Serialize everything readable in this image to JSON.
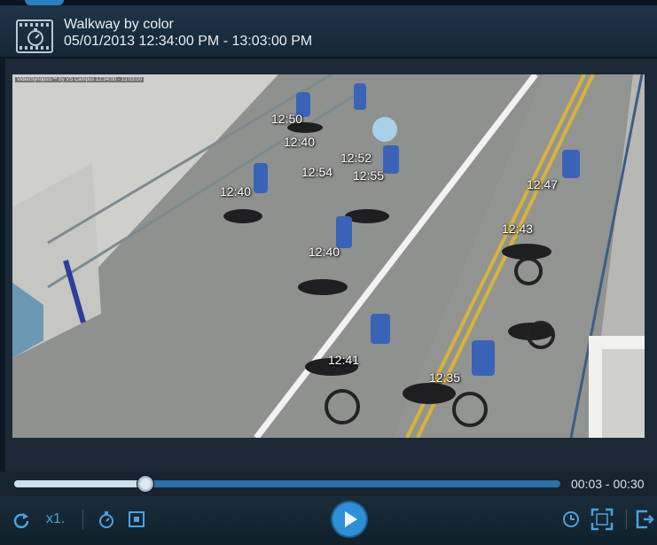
{
  "header": {
    "title": "Walkway by color",
    "time_range": "05/01/2013 12:34:00 PM - 13:03:00 PM",
    "icon": "film-stopwatch-icon"
  },
  "video": {
    "overlay_label": "VideoSynopsis™ by VS Campus  12:34:00 - 13:03:00",
    "timestamps": [
      "12:50",
      "12:40",
      "12:52",
      "12:54",
      "12:55",
      "12:40",
      "12:40",
      "12:47",
      "12:43",
      "12:41",
      "12:35"
    ]
  },
  "playback": {
    "range": "00:03 - 00:30",
    "progress_fraction": 0.24,
    "speed": "x1.",
    "colors": {
      "accent": "#2e8fd6",
      "track": "#2b6fa6",
      "fill": "#cde0ee"
    }
  },
  "icons": {
    "repeat": "repeat-icon",
    "stopwatch": "stopwatch-icon",
    "snapshot": "snapshot-icon",
    "play": "play-icon",
    "clock": "clock-icon",
    "fullscreen": "fullscreen-icon",
    "export": "export-icon"
  }
}
